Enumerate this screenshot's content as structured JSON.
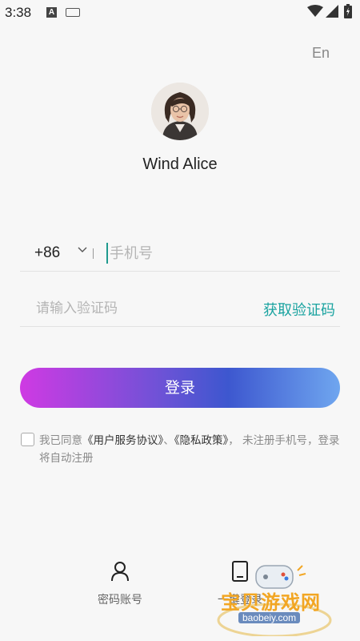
{
  "status_bar": {
    "time": "3:38",
    "notif_letter": "A"
  },
  "header": {
    "language_link": "En"
  },
  "profile": {
    "name": "Wind Alice"
  },
  "form": {
    "country_code": "+86",
    "phone_placeholder": "手机号",
    "code_placeholder": "请输入验证码",
    "get_code_label": "获取验证码",
    "login_label": "登录"
  },
  "agreement": {
    "prefix": "我已同意",
    "user_agreement": "《用户服务协议》",
    "separator": "、",
    "privacy_policy": "《隐私政策》",
    "suffix": "， 未注册手机号，登录将自动注册"
  },
  "bottom_options": {
    "password_login": "密码账号",
    "onekey_login": "一键登录"
  },
  "watermark": {
    "title": "宝贝游戏网",
    "url": "baobeiy.com"
  },
  "colors": {
    "accent": "#1aa3a0",
    "gradient_start": "#cf3ae3",
    "gradient_end": "#6fa6ef"
  }
}
